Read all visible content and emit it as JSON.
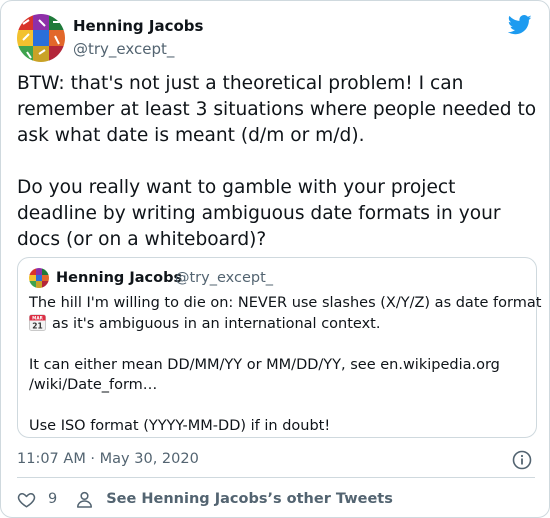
{
  "tweet": {
    "author_name": "Henning Jacobs",
    "author_handle": "@try_except_",
    "text": "BTW: that's not just a theoretical problem! I can remember at least 3 situations where people needed to ask what date is meant (d/m or m/d).\n\nDo you really want to gamble with your project deadline by writing ambiguous date formats in your docs (or on a whiteboard)?",
    "timestamp": "11:07 AM · May 30, 2020",
    "likes": "9",
    "profile_link": "See Henning Jacobs’s other Tweets"
  },
  "quoted": {
    "author_name": "Henning Jacobs",
    "author_handle": "@try_except_",
    "lines": [
      "The hill I'm willing to die on: NEVER use slashes (X/Y/Z) as date format",
      "as it's ambiguous in an international context.",
      "",
      "It can either mean DD/MM/YY or MM/DD/YY, see en.wikipedia.org",
      "/wiki/Date_form…",
      "",
      "Use ISO format (YYYY-MM-DD) if in doubt!"
    ],
    "calendar_emoji_label": "MAR 21"
  },
  "colors": {
    "brand_blue": "#1d9bf0",
    "text": "#0f1419",
    "secondary_text": "#536471",
    "border": "#cfd9de"
  },
  "icons": {
    "brand": "twitter-bird-icon",
    "info": "info-icon",
    "like": "heart-icon",
    "profile": "person-icon",
    "calendar": "calendar-emoji-icon"
  }
}
